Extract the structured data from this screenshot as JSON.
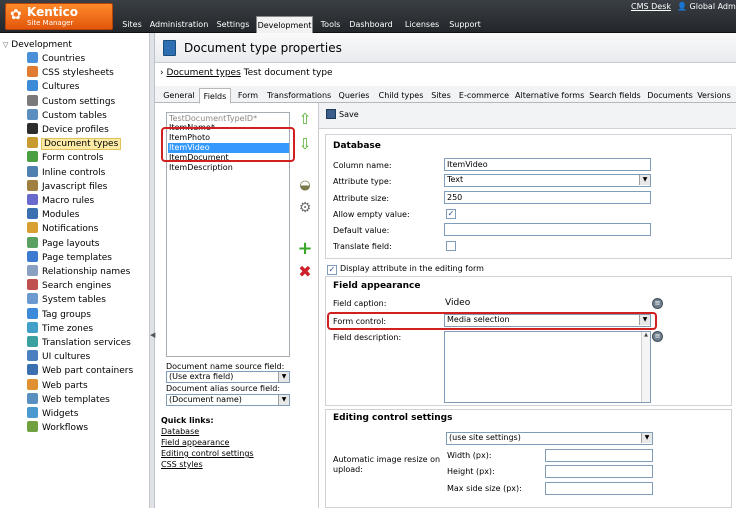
{
  "brand": {
    "name": "Kentico",
    "sub": "Site Manager"
  },
  "nav": {
    "tabs": [
      "Sites",
      "Administration",
      "Settings",
      "Development",
      "Tools",
      "Dashboard",
      "Licenses",
      "Support"
    ],
    "active": "Development"
  },
  "toplinks": {
    "cms_desk": "CMS Desk",
    "user": "Global Admin"
  },
  "tree": {
    "root": "Development",
    "items": [
      "Countries",
      "CSS stylesheets",
      "Cultures",
      "Custom settings",
      "Custom tables",
      "Device profiles",
      "Document types",
      "Form controls",
      "Inline controls",
      "Javascript files",
      "Macro rules",
      "Modules",
      "Notifications",
      "Page layouts",
      "Page templates",
      "Relationship names",
      "Search engines",
      "System tables",
      "Tag groups",
      "Time zones",
      "Translation services",
      "UI cultures",
      "Web part containers",
      "Web parts",
      "Web templates",
      "Widgets",
      "Workflows"
    ],
    "selected": "Document types"
  },
  "page": {
    "title": "Document type properties"
  },
  "breadcrumb": {
    "link": "Document types",
    "current": "Test document type"
  },
  "tabs": [
    "General",
    "Fields",
    "Form",
    "Transformations",
    "Queries",
    "Child types",
    "Sites",
    "E-commerce",
    "Alternative forms",
    "Search fields",
    "Documents",
    "Versions"
  ],
  "fields_list": [
    "TestDocumentTypeID*",
    "ItemName*",
    "ItemPhoto",
    "ItemVideo",
    "ItemDocument",
    "ItemDescription"
  ],
  "left_form": {
    "name_source_label": "Document name source field:",
    "name_source_value": "(Use extra field)",
    "alias_source_label": "Document alias source field:",
    "alias_source_value": "(Document name)"
  },
  "quick_links": {
    "title": "Quick links:",
    "links": [
      "Database",
      "Field appearance",
      "Editing control settings",
      "CSS styles"
    ]
  },
  "toolbar": {
    "save_label": "Save"
  },
  "database": {
    "title": "Database",
    "column_name_label": "Column name:",
    "column_name": "ItemVideo",
    "attribute_type_label": "Attribute type:",
    "attribute_type": "Text",
    "attribute_size_label": "Attribute size:",
    "attribute_size": "250",
    "allow_empty_label": "Allow empty value:",
    "default_value_label": "Default value:",
    "translate_label": "Translate field:"
  },
  "display_attr_label": "Display attribute in the editing form",
  "appearance": {
    "title": "Field appearance",
    "caption_label": "Field caption:",
    "caption_value": "Video",
    "form_control_label": "Form control:",
    "form_control_value": "Media selection",
    "description_label": "Field description:"
  },
  "editing": {
    "title": "Editing control settings",
    "resize_label": "Automatic image resize on upload:",
    "resize_value": "(use site settings)",
    "width_label": "Width (px):",
    "height_label": "Height (px):",
    "max_label": "Max side size (px):"
  }
}
